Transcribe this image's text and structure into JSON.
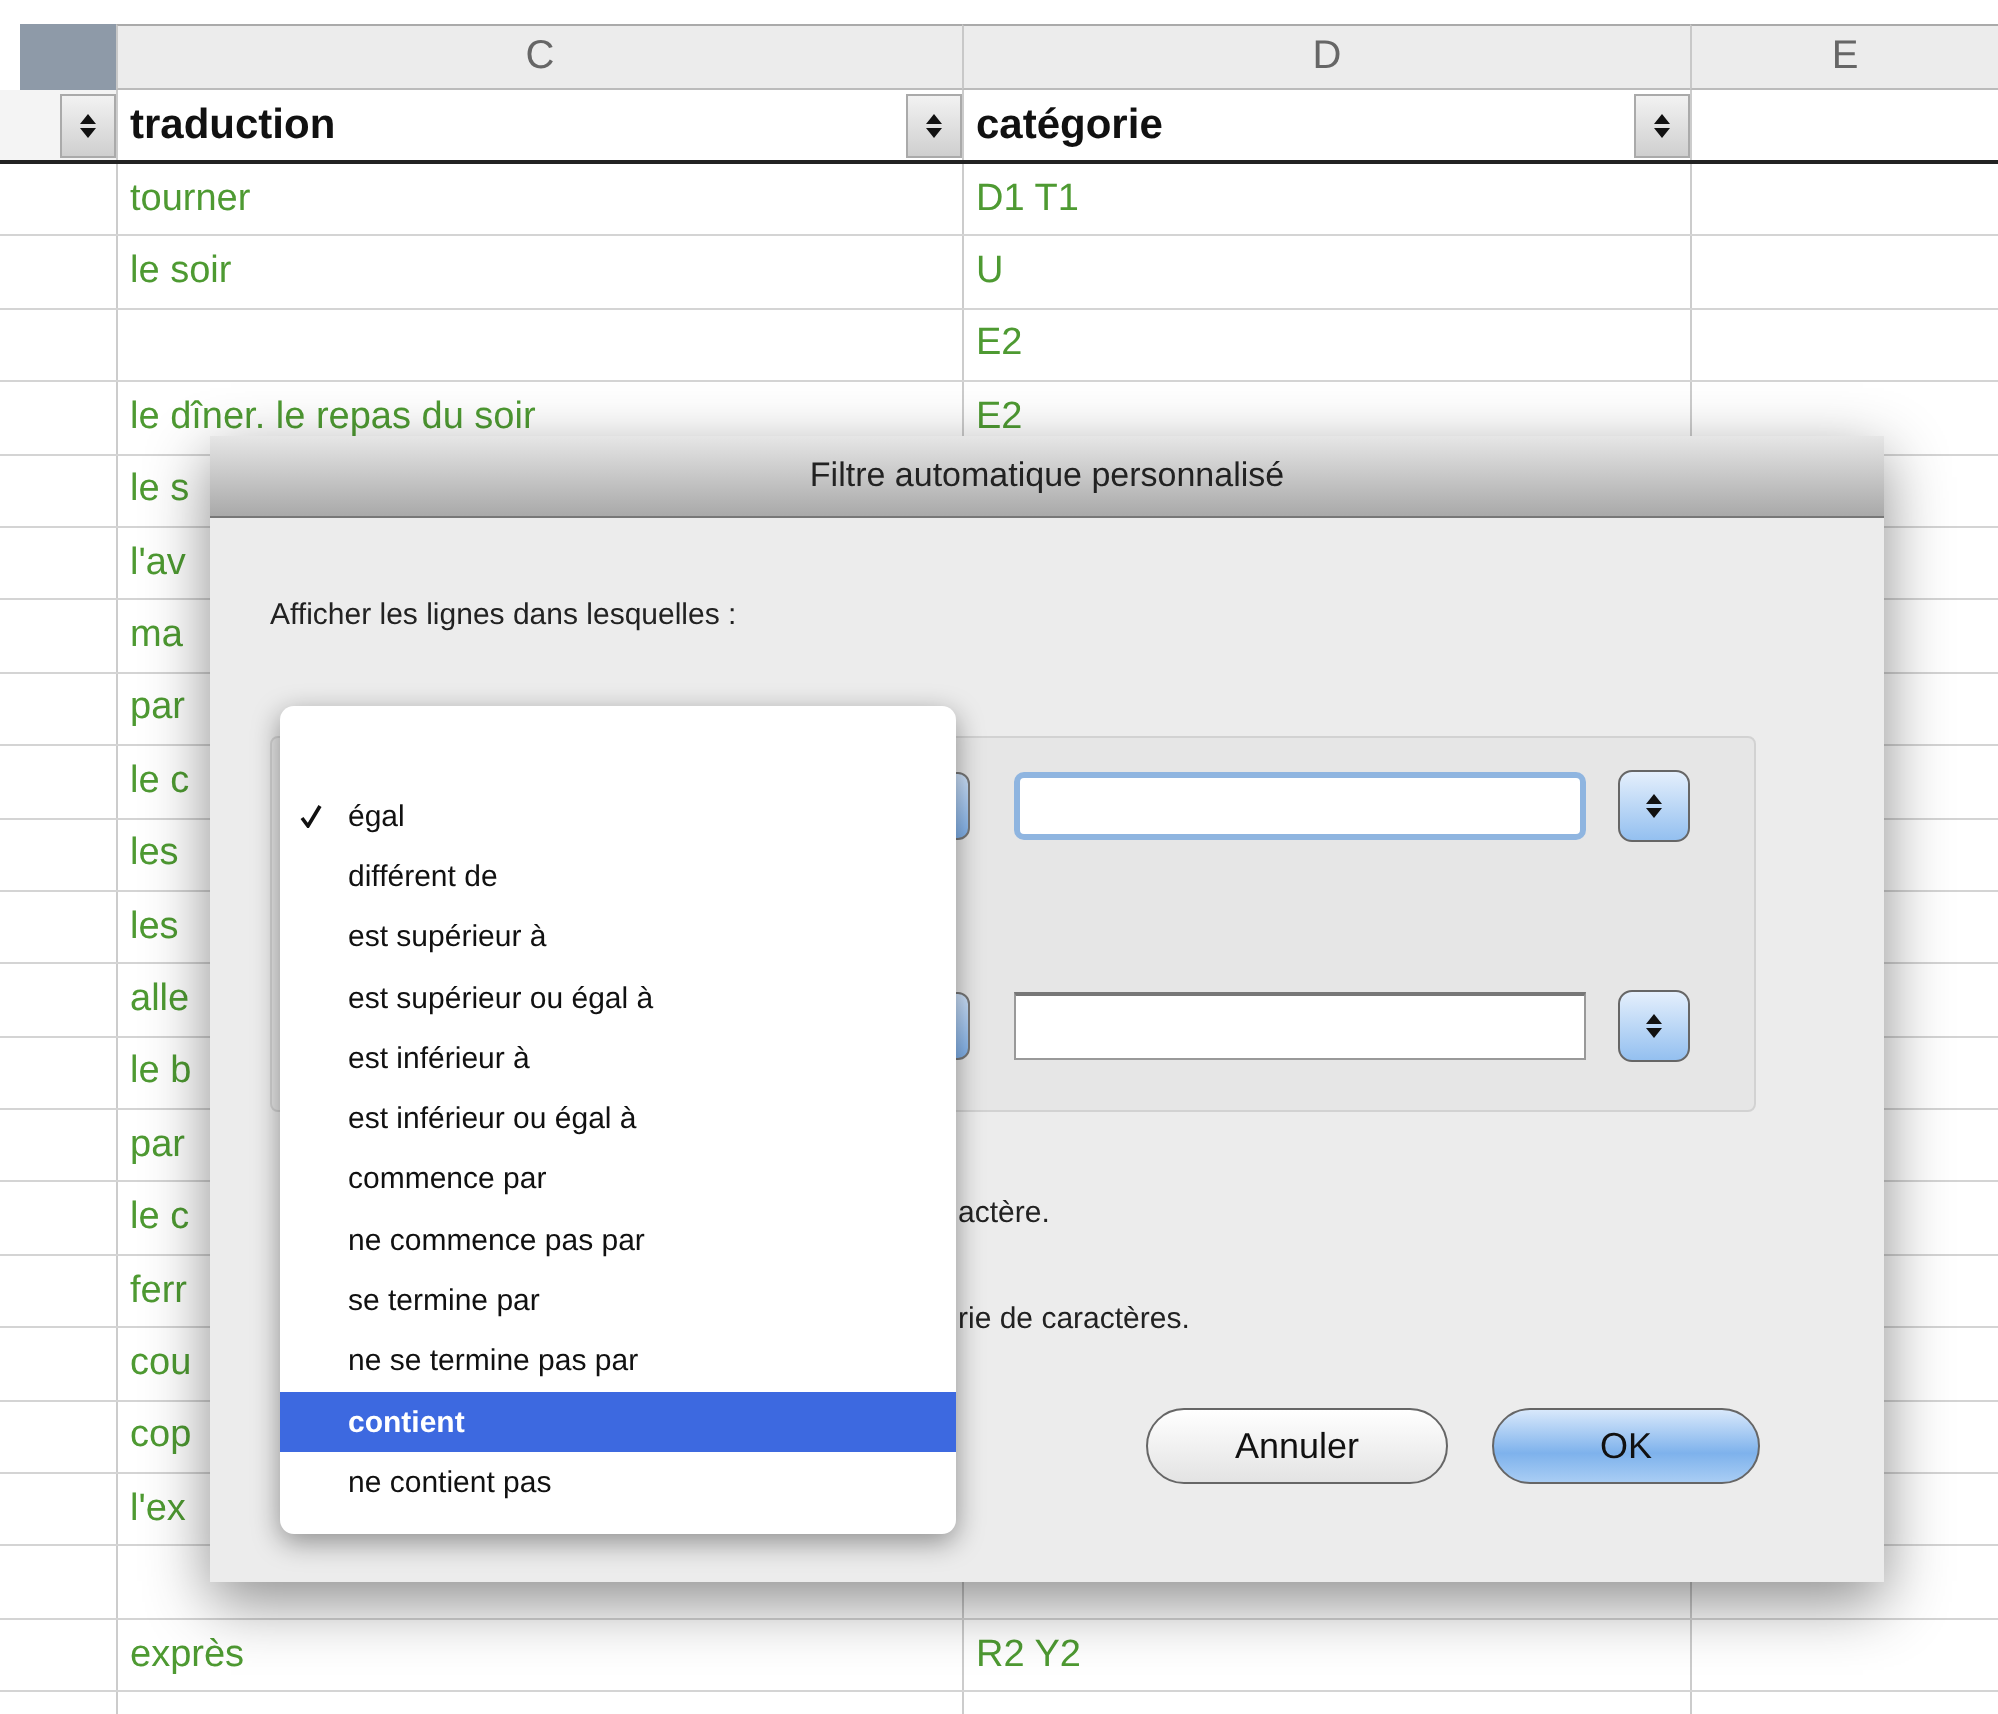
{
  "columns": [
    {
      "label": "C"
    },
    {
      "label": "D"
    },
    {
      "label": "E"
    }
  ],
  "header": [
    {
      "label": "traduction"
    },
    {
      "label": "catégorie"
    }
  ],
  "rows": [
    {
      "c": "tourner",
      "d": "D1 T1"
    },
    {
      "c": "le soir",
      "d": "U"
    },
    {
      "d": "E2"
    },
    {
      "c": "le dîner. le repas du soir",
      "d": "E2"
    },
    {
      "c": "le s"
    },
    {
      "c": "l'av"
    },
    {
      "c": "ma"
    },
    {
      "c": "par"
    },
    {
      "c": "le c"
    },
    {
      "c": "les"
    },
    {
      "c": "les"
    },
    {
      "c": "alle"
    },
    {
      "c": "le b"
    },
    {
      "c": "par"
    },
    {
      "c": "le c"
    },
    {
      "c": "ferr"
    },
    {
      "c": "cou"
    },
    {
      "c": "cop"
    },
    {
      "c": "l'ex"
    },
    {},
    {
      "c": "exprès",
      "d": "R2 Y2"
    },
    {}
  ],
  "dialog": {
    "title": "Filtre automatique personnalisé",
    "prompt": "Afficher les lignes dans lesquelles :",
    "fields": [
      {
        "focused": true
      },
      {
        "focused": false
      }
    ],
    "notes": [
      "actère.",
      "rie de caractères."
    ],
    "buttons": [
      {
        "label": "Annuler",
        "default": false
      },
      {
        "label": "OK",
        "default": true
      }
    ]
  },
  "menu": {
    "items": [
      {
        "label": "égal",
        "checked": true,
        "selected": false
      },
      {
        "label": "différent de",
        "checked": false,
        "selected": false
      },
      {
        "label": "est supérieur à",
        "checked": false,
        "selected": false
      },
      {
        "label": "est supérieur ou égal à",
        "checked": false,
        "selected": false
      },
      {
        "label": "est inférieur à",
        "checked": false,
        "selected": false
      },
      {
        "label": "est inférieur ou égal à",
        "checked": false,
        "selected": false
      },
      {
        "label": "commence par",
        "checked": false,
        "selected": false
      },
      {
        "label": "ne commence pas par",
        "checked": false,
        "selected": false
      },
      {
        "label": "se termine par",
        "checked": false,
        "selected": false
      },
      {
        "label": "ne se termine pas par",
        "checked": false,
        "selected": false
      },
      {
        "label": "contient",
        "checked": false,
        "selected": true
      },
      {
        "label": "ne contient pas",
        "checked": false,
        "selected": false
      }
    ]
  }
}
